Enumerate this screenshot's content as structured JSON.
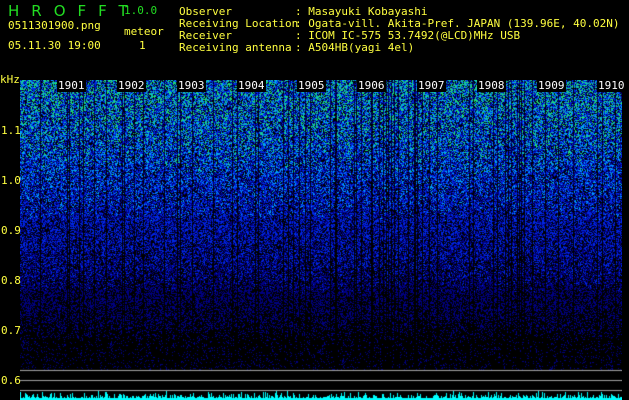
{
  "header": {
    "app_title": "HROFFT",
    "version": "1.0.0",
    "filename": "0511301900.png",
    "datetime": "05.11.30 19:00",
    "meteor_label": "meteor",
    "meteor_count": "1"
  },
  "info": [
    {
      "label": "Observer",
      "value": ": Masayuki Kobayashi"
    },
    {
      "label": "Receiving Location",
      "value": ": Ogata-vill. Akita-Pref. JAPAN (139.96E, 40.02N)"
    },
    {
      "label": "Receiver",
      "value": ": ICOM IC-575 53.7492(@LCD)MHz USB"
    },
    {
      "label": "Receiving antenna",
      "value": ": A504HB(yagi 4el)"
    }
  ],
  "axis": {
    "unit": "kHz",
    "freq_ticks": [
      "1.1",
      "1.0",
      "0.9",
      "0.8",
      "0.7",
      "0.6"
    ],
    "minute_labels": [
      "1901",
      "1902",
      "1903",
      "1904",
      "1905",
      "1906",
      "1907",
      "1908",
      "1909",
      "1910"
    ]
  },
  "colors": {
    "text": "#ffff40",
    "title": "#22dd22",
    "histogram": "#00ffff",
    "lines": "#a0a0a0"
  }
}
